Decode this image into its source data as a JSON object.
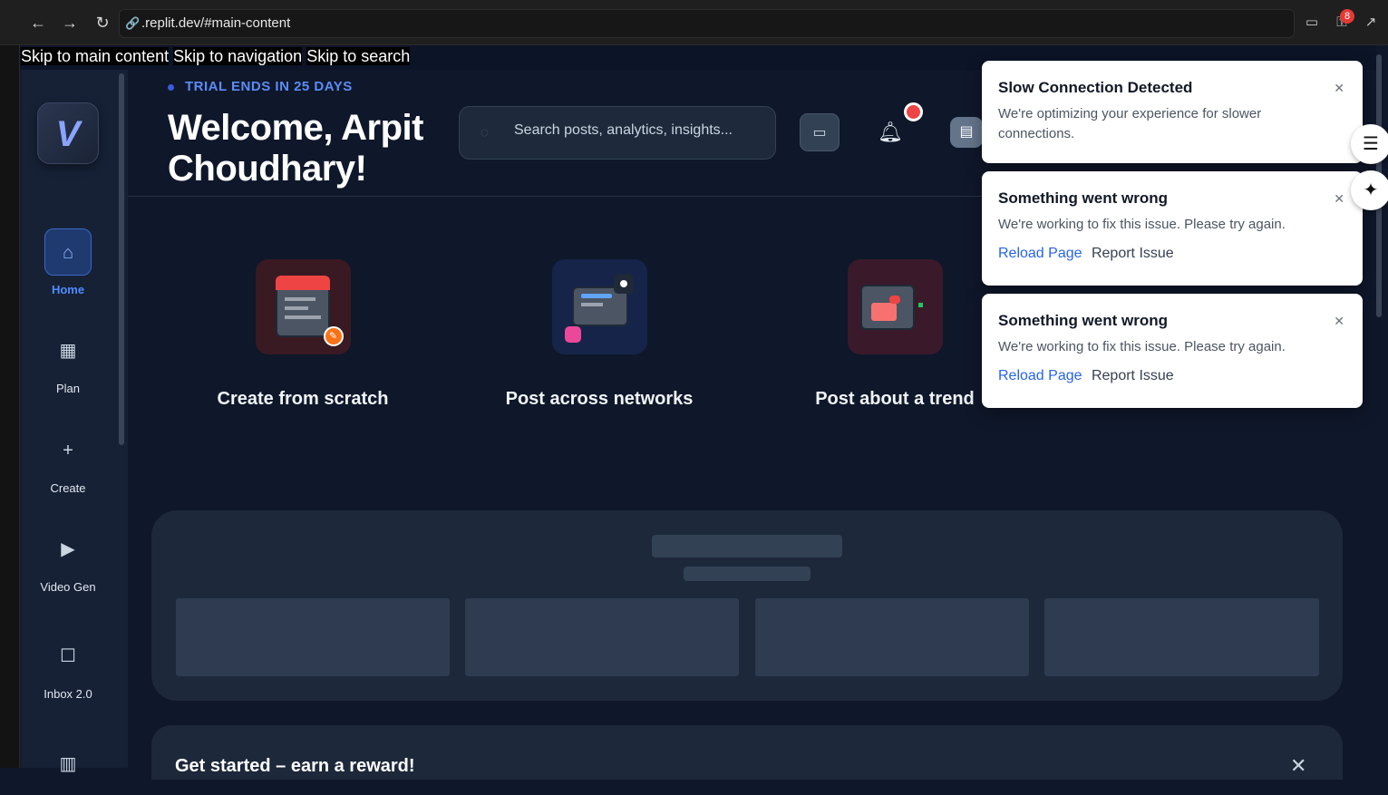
{
  "browser": {
    "url": ".replit.dev/#main-content",
    "extension_badge": "8"
  },
  "skip_links": [
    "Skip to main content",
    "Skip to navigation",
    "Skip to search"
  ],
  "sidebar": {
    "logo": "V",
    "items": [
      {
        "label": "Home",
        "icon": "home-icon",
        "active": true
      },
      {
        "label": "Plan",
        "icon": "calendar-icon"
      },
      {
        "label": "Create",
        "icon": "plus-icon"
      },
      {
        "label": "Video Gen",
        "icon": "video-icon"
      },
      {
        "label": "Inbox 2.0",
        "icon": "chat-icon"
      }
    ]
  },
  "header": {
    "trial": "TRIAL ENDS IN 25 DAYS",
    "welcome": "Welcome, Arpit Choudhary!",
    "search_placeholder": "Search posts, analytics, insights..."
  },
  "quick_actions": [
    {
      "title": "Create from scratch",
      "icon": "document-edit-icon",
      "color": "#3a1a22"
    },
    {
      "title": "Post across networks",
      "icon": "share-network-icon",
      "color": "#16244a"
    },
    {
      "title": "Post about a trend",
      "icon": "trend-folder-icon",
      "color": "#3a1a2a"
    }
  ],
  "reward": {
    "title": "Get started – earn a reward!"
  },
  "toasts": [
    {
      "title": "Slow Connection Detected",
      "message": "We're optimizing your experience for slower connections."
    },
    {
      "title": "Something went wrong",
      "message": "We're working to fix this issue. Please try again.",
      "reload": "Reload Page",
      "report": "Report Issue"
    },
    {
      "title": "Something went wrong",
      "message": "We're working to fix this issue. Please try again.",
      "reload": "Reload Page",
      "report": "Report Issue"
    }
  ],
  "colors": {
    "accent": "#4f8cff",
    "background": "#0f172a",
    "sidebar": "#162136",
    "error_badge": "#ef4444"
  }
}
